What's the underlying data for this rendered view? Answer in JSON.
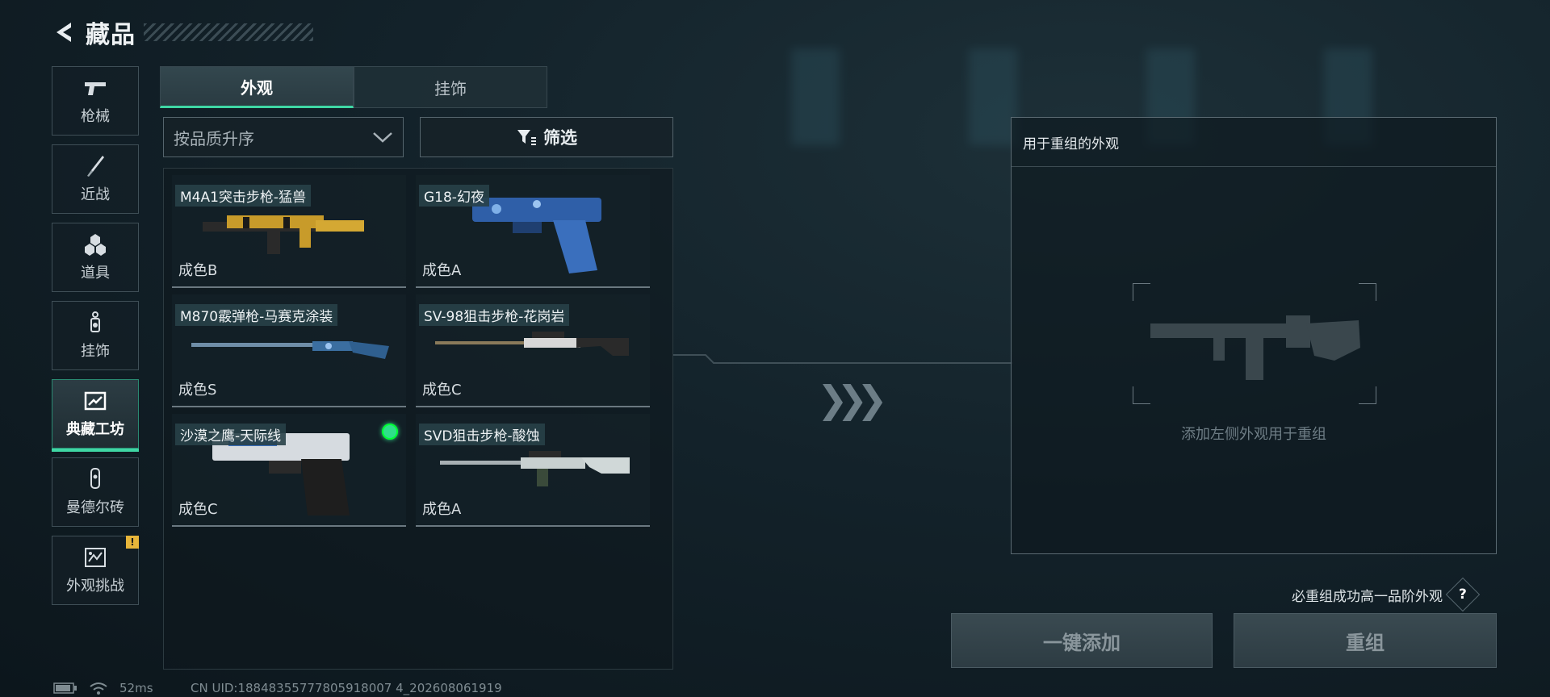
{
  "header": {
    "title": "藏品"
  },
  "sidebar": {
    "items": [
      {
        "label": "枪械",
        "icon": "pistol-icon"
      },
      {
        "label": "近战",
        "icon": "knife-icon"
      },
      {
        "label": "道具",
        "icon": "items-icon"
      },
      {
        "label": "挂饰",
        "icon": "charm-icon"
      },
      {
        "label": "典藏工坊",
        "icon": "workshop-icon",
        "active": true
      },
      {
        "label": "曼德尔砖",
        "icon": "brick-icon"
      },
      {
        "label": "外观挑战",
        "icon": "challenge-icon",
        "badge": "!"
      }
    ]
  },
  "tabs": [
    {
      "label": "外观",
      "active": true
    },
    {
      "label": "挂饰",
      "active": false
    }
  ],
  "sort": {
    "label": "按品质升序"
  },
  "filter": {
    "label": "筛选"
  },
  "items": [
    {
      "name": "M4A1突击步枪-猛兽",
      "grade": "成色B"
    },
    {
      "name": "G18-幻夜",
      "grade": "成色A"
    },
    {
      "name": "M870霰弹枪-马赛克涂装",
      "grade": "成色S"
    },
    {
      "name": "SV-98狙击步枪-花岗岩",
      "grade": "成色C"
    },
    {
      "name": "沙漠之鹰-天际线",
      "grade": "成色C",
      "selected": true
    },
    {
      "name": "SVD狙击步枪-酸蚀",
      "grade": "成色A"
    }
  ],
  "reform": {
    "header": "用于重组的外观",
    "hint": "添加左侧外观用于重组",
    "guarantee": "必重组成功高一品阶外观",
    "help": "?",
    "add_button": "一键添加",
    "reform_button": "重组"
  },
  "status": {
    "ping": "52ms",
    "uid": "CN UID:18848355777805918007 4_202608061919"
  },
  "colors": {
    "accent": "#3fd7a4",
    "warning": "#e7b53a",
    "selected_dot": "#2fe08a"
  }
}
